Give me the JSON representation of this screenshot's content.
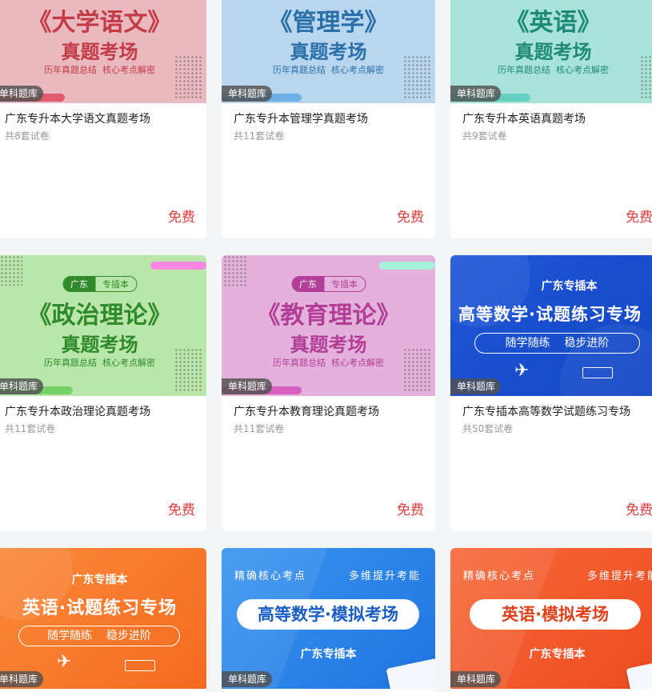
{
  "badge": "单科题库",
  "cards": [
    {
      "title": "广东专升本大学语文真题考场",
      "count": "共8套试卷",
      "price": "免费",
      "banner": {
        "main": "《大学语文》",
        "sub": "真题考场",
        "tagline": "历年真题总结  核心考点解密",
        "bg": "#eab8bf",
        "accent": "#c23b46"
      }
    },
    {
      "title": "广东专升本管理学真题考场",
      "count": "共11套试卷",
      "price": "免费",
      "banner": {
        "main": "《管理学》",
        "sub": "真题考场",
        "tagline": "历年真题总结  核心考点解密",
        "bg": "#b9d6ef",
        "accent": "#2b6fa8"
      }
    },
    {
      "title": "广东专升本英语真题考场",
      "count": "共9套试卷",
      "price": "免费",
      "banner": {
        "main": "《英语》",
        "sub": "真题考场",
        "tagline": "历年真题总结  核心考点解密",
        "bg": "#a8e3d9",
        "accent": "#1f8a75"
      }
    },
    {
      "title": "广东专升本政治理论真题考场",
      "count": "共11套试卷",
      "price": "免费",
      "banner": {
        "main": "《政治理论》",
        "sub": "真题考场",
        "tagline": "历年真题总结  核心考点解密",
        "pill_left": "广东",
        "pill_right": "专插本",
        "bg": "#b9e6a9",
        "accent": "#2f8a2b"
      }
    },
    {
      "title": "广东专升本教育理论真题考场",
      "count": "共11套试卷",
      "price": "免费",
      "banner": {
        "main": "《教育理论》",
        "sub": "真题考场",
        "tagline": "历年真题总结  核心考点解密",
        "pill_left": "广东",
        "pill_right": "专插本",
        "bg": "#e3b1dc",
        "accent": "#b23e96"
      }
    },
    {
      "title": "广东专插本高等数学试题练习专场",
      "count": "共50套试卷",
      "price": "免费",
      "banner": {
        "top": "广东专插本",
        "main": "高等数学·试题练习专场",
        "pill": "随学随练    稳步进阶",
        "bg": "#1e57d9"
      }
    },
    {
      "banner": {
        "top": "广东专插本",
        "main": "英语·试题练习专场",
        "pill": "随学随练    稳步进阶",
        "bg": "#f97a2c"
      }
    },
    {
      "banner": {
        "top_left": "精确核心考点",
        "top_right": "多维提升考能",
        "main": "高等数学·模拟考场",
        "bottom": "广东专插本",
        "bg": "#2a86e8",
        "text_color": "#1a5dc4"
      }
    },
    {
      "banner": {
        "top_left": "精确核心考点",
        "top_right": "多维提升考能",
        "main": "英语·模拟考场",
        "bottom": "广东专插本",
        "bg": "#f45a2e",
        "text_color": "#e0401a"
      }
    }
  ]
}
